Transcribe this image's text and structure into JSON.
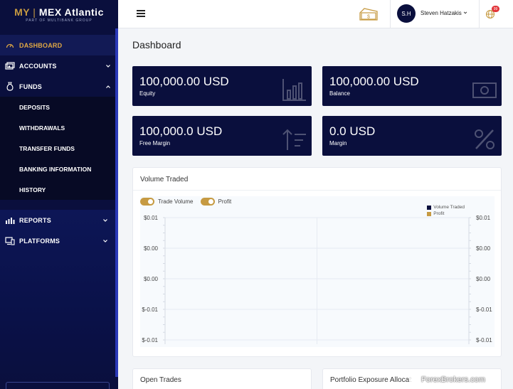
{
  "brand": {
    "logo_my": "MY",
    "logo_sep": "|",
    "logo_name": "MEX Atlantic",
    "logo_sub": "PART OF MULTIBANK GROUP"
  },
  "sidebar": {
    "items": [
      {
        "label": "DASHBOARD"
      },
      {
        "label": "ACCOUNTS"
      },
      {
        "label": "FUNDS"
      },
      {
        "label": "REPORTS"
      },
      {
        "label": "PLATFORMS"
      }
    ],
    "funds_sub": [
      "DEPOSITS",
      "WITHDRAWALS",
      "TRANSFER FUNDS",
      "BANKING INFORMATION",
      "HISTORY"
    ]
  },
  "topbar": {
    "avatar_initials": "S.H",
    "user_name": "Steven Hatzakis",
    "notification_count": "99"
  },
  "main": {
    "title": "Dashboard",
    "cards": [
      {
        "value": "100,000.00 USD",
        "label": "Equity",
        "icon": "bar-chart-icon"
      },
      {
        "value": "100,000.00 USD",
        "label": "Balance",
        "icon": "banknote-icon"
      },
      {
        "value": "100,000.0 USD",
        "label": "Free Margin",
        "icon": "sort-icon"
      },
      {
        "value": "0.0 USD",
        "label": "Margin",
        "icon": "percent-icon"
      }
    ],
    "volume_panel": {
      "title": "Volume Traded",
      "toggle_trade_volume": "Trade Volume",
      "toggle_profit": "Profit"
    },
    "open_trades_title": "Open Trades",
    "portfolio_title": "Portfolio Exposure Allocat"
  },
  "chart_data": {
    "type": "line",
    "series": [
      {
        "name": "Volume Traded",
        "values": []
      },
      {
        "name": "Profit",
        "values": []
      }
    ],
    "y_ticks_left": [
      "$0.01",
      "$0.00",
      "$0.00",
      "$-0.01",
      "$-0.01"
    ],
    "y_ticks_right": [
      "$0.01",
      "$0.00",
      "$0.00",
      "$-0.01",
      "$-0.01"
    ],
    "ylim": [
      -0.01,
      0.01
    ],
    "grid": true,
    "legend_position": "top-right",
    "colors": {
      "Volume Traded": "#0a0f3d",
      "Profit": "#c69a42"
    }
  },
  "watermark": "ForexBrokers.com",
  "colors": {
    "navy": "#0a0f3d",
    "gold": "#c69a42",
    "accent": "#e0a844"
  }
}
